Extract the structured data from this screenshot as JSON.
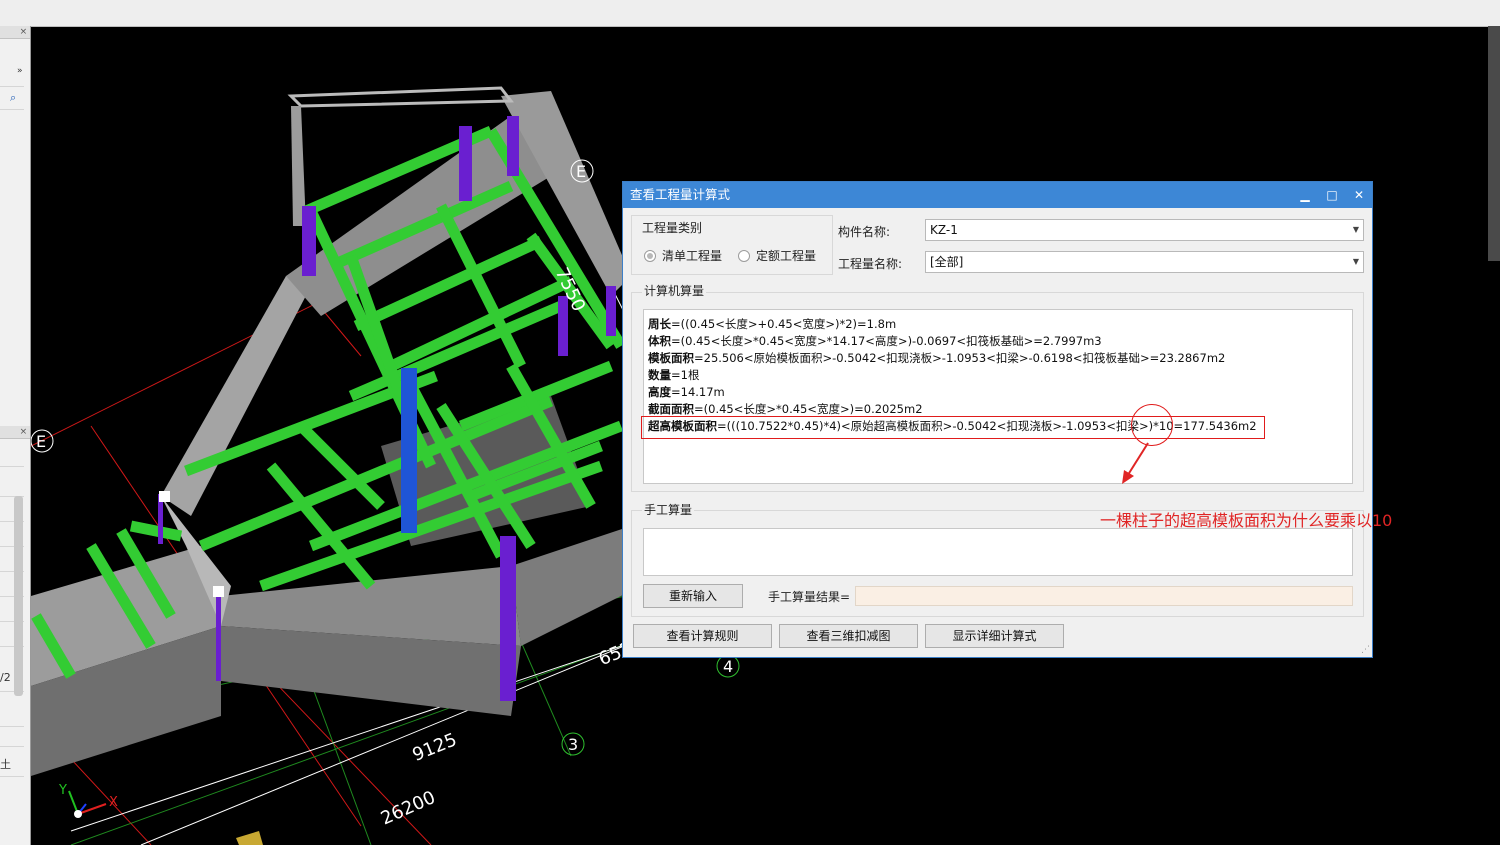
{
  "window": {
    "title": "查看工程量计算式"
  },
  "dialog": {
    "qty_type": {
      "group_label": "工程量类别",
      "options": [
        {
          "label": "清单工程量",
          "selected": true
        },
        {
          "label": "定额工程量",
          "selected": false
        }
      ]
    },
    "component_label": "构件名称:",
    "component_value": "KZ-1",
    "qty_name_label": "工程量名称:",
    "qty_name_value": "[全部]",
    "calc_section_label": "计算机算量",
    "formulas": [
      {
        "name": "周长",
        "expr": "=((0.45<长度>+0.45<宽度>)*2)=1.8m"
      },
      {
        "name": "体积",
        "expr": "=(0.45<长度>*0.45<宽度>*14.17<高度>)-0.0697<扣筏板基础>=2.7997m3"
      },
      {
        "name": "模板面积",
        "expr": "=25.506<原始模板面积>-0.5042<扣现浇板>-1.0953<扣梁>-0.6198<扣筏板基础>=23.2867m2"
      },
      {
        "name": "数量",
        "expr": "=1根"
      },
      {
        "name": "高度",
        "expr": "=14.17m"
      },
      {
        "name": "截面面积",
        "expr": "=(0.45<长度>*0.45<宽度>)=0.2025m2"
      },
      {
        "name": "超高模板面积",
        "expr": "=(((10.7522*0.45)*4)<原始超高模板面积>-0.5042<扣现浇板>-1.0953<扣梁>)*10=177.5436m2"
      }
    ],
    "manual_section_label": "手工算量",
    "reinput_button": "重新输入",
    "manual_result_label": "手工算量结果=",
    "buttons": {
      "view_rules": "查看计算规则",
      "view_3d": "查看三维扣减图",
      "show_detail": "显示详细计算式"
    }
  },
  "annotation": {
    "text": "一棵柱子的超高模板面积为什么要乘以10",
    "color": "#e02525"
  },
  "viewport": {
    "dimensions": [
      "7550",
      "9125",
      "26200",
      "652"
    ],
    "axis_markers": [
      "E",
      "E",
      "3",
      "4"
    ],
    "axes": {
      "x": "X",
      "y": "Y"
    }
  },
  "left_panel": {
    "fragments": [
      "/2",
      "土"
    ]
  },
  "colors": {
    "title_bar": "#3d87d6",
    "beam_green": "#33cc33",
    "column_purple": "#6a1fd0",
    "column_blue": "#1f55d6",
    "wall_gray": "#8a8a8a",
    "annotation_red": "#e02525"
  }
}
